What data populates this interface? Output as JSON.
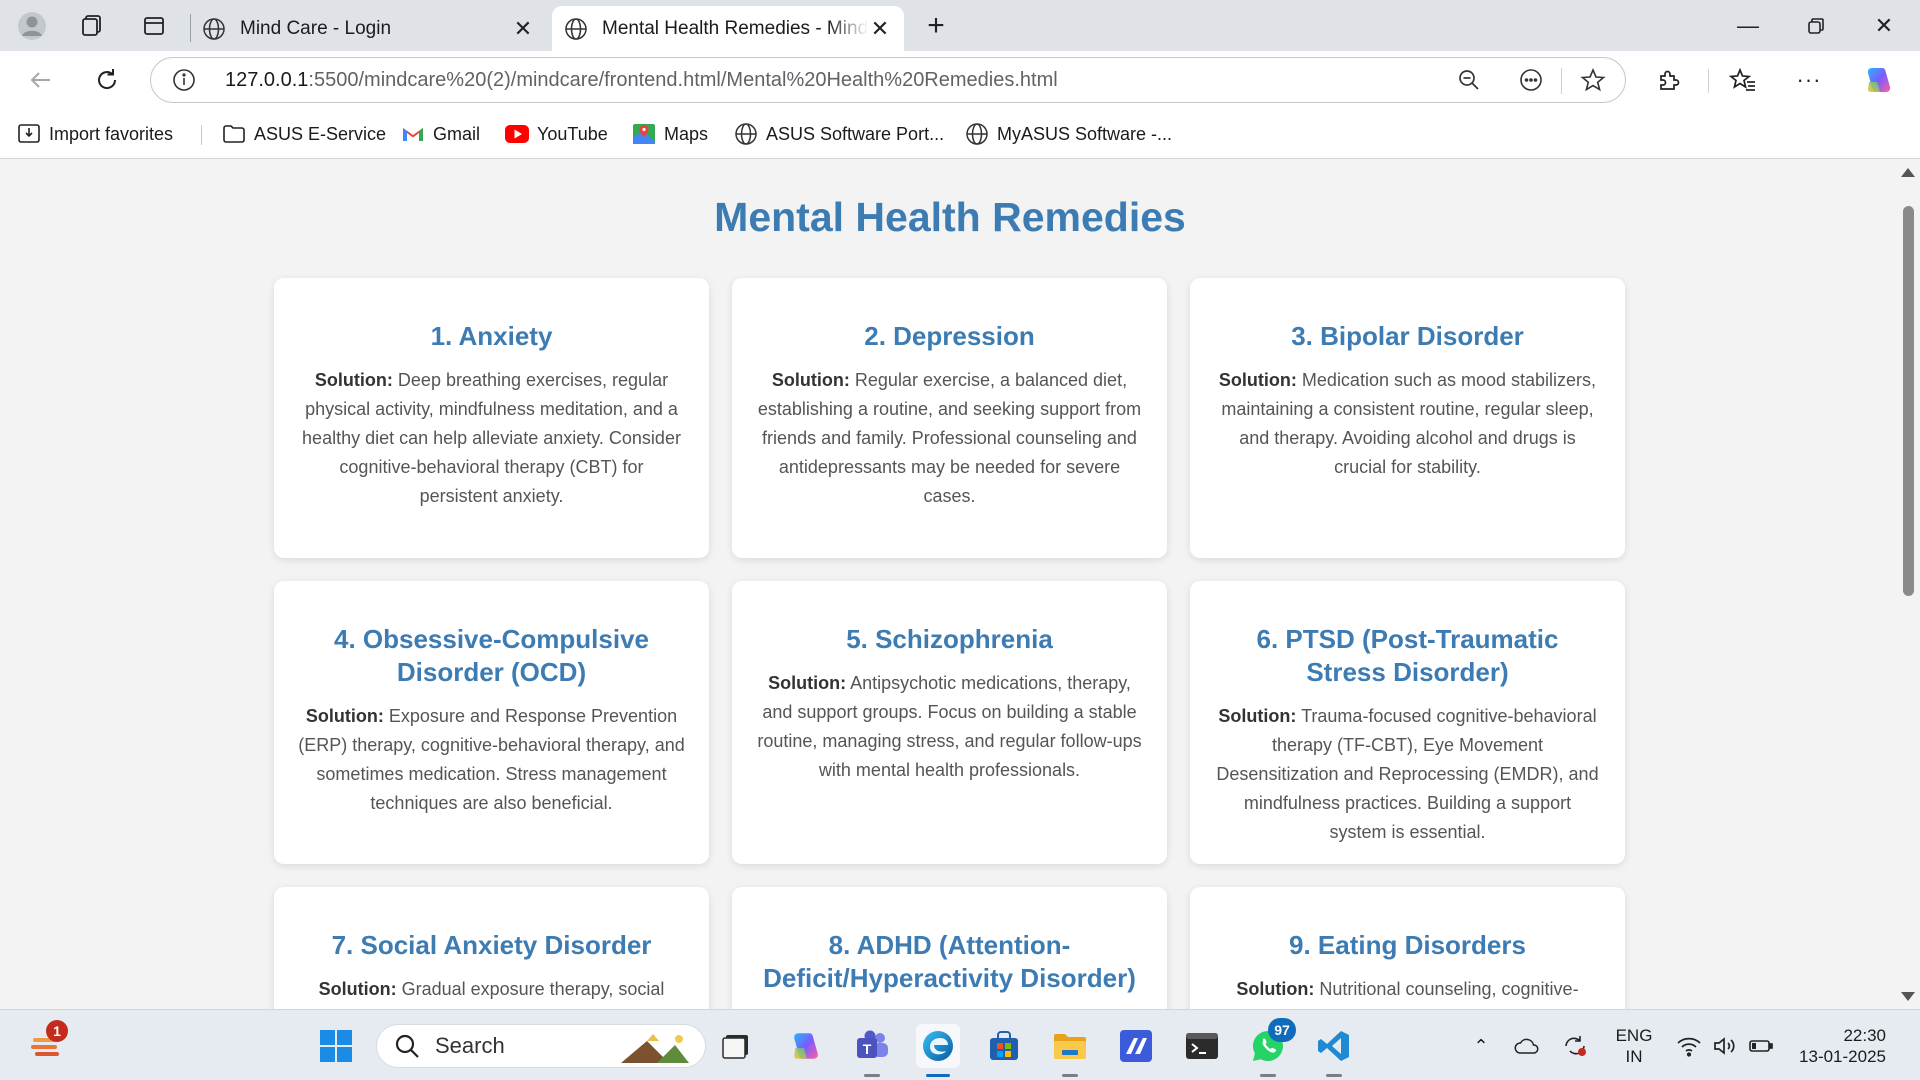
{
  "browser": {
    "tabs": [
      {
        "title": "Mind Care - Login"
      },
      {
        "title": "Mental Health Remedies - Mind Care"
      }
    ],
    "address": {
      "host": "127.0.0.1",
      "path": ":5500/mindcare%20(2)/mindcare/frontend.html/Mental%20Health%20Remedies.html"
    },
    "favorites": [
      {
        "label": "Import favorites",
        "icon": "import-favorites-icon"
      },
      {
        "label": "ASUS E-Service",
        "icon": "folder-icon"
      },
      {
        "label": "Gmail",
        "icon": "gmail-icon"
      },
      {
        "label": "YouTube",
        "icon": "youtube-icon"
      },
      {
        "label": "Maps",
        "icon": "maps-icon"
      },
      {
        "label": "ASUS Software Port...",
        "icon": "globe-icon"
      },
      {
        "label": "MyASUS Software -...",
        "icon": "globe-icon"
      }
    ]
  },
  "page": {
    "title": "Mental Health Remedies",
    "solution_label": "Solution:",
    "cards": [
      {
        "title": "1. Anxiety",
        "text": "Deep breathing exercises, regular physical activity, mindfulness meditation, and a healthy diet can help alleviate anxiety. Consider cognitive-behavioral therapy (CBT) for persistent anxiety."
      },
      {
        "title": "2. Depression",
        "text": "Regular exercise, a balanced diet, establishing a routine, and seeking support from friends and family. Professional counseling and antidepressants may be needed for severe cases."
      },
      {
        "title": "3. Bipolar Disorder",
        "text": "Medication such as mood stabilizers, maintaining a consistent routine, regular sleep, and therapy. Avoiding alcohol and drugs is crucial for stability."
      },
      {
        "title": "4. Obsessive-Compulsive Disorder (OCD)",
        "text": "Exposure and Response Prevention (ERP) therapy, cognitive-behavioral therapy, and sometimes medication. Stress management techniques are also beneficial."
      },
      {
        "title": "5. Schizophrenia",
        "text": "Antipsychotic medications, therapy, and support groups. Focus on building a stable routine, managing stress, and regular follow-ups with mental health professionals."
      },
      {
        "title": "6. PTSD (Post-Traumatic Stress Disorder)",
        "text": "Trauma-focused cognitive-behavioral therapy (TF-CBT), Eye Movement Desensitization and Reprocessing (EMDR), and mindfulness practices. Building a support system is essential."
      },
      {
        "title": "7. Social Anxiety Disorder",
        "text": "Gradual exposure therapy, social skills"
      },
      {
        "title": "8. ADHD (Attention-Deficit/Hyperactivity Disorder)",
        "text": ""
      },
      {
        "title": "9. Eating Disorders",
        "text": "Nutritional counseling, cognitive-"
      }
    ]
  },
  "taskbar": {
    "search_label": "Search",
    "widgets_badge": "1",
    "whatsapp_badge": "97",
    "lang_line1": "ENG",
    "lang_line2": "IN",
    "time": "22:30",
    "date": "13-01-2025"
  },
  "colors": {
    "accent": "#3d7bb3",
    "page_bg": "#f3f3f3",
    "card_bg": "#ffffff"
  }
}
